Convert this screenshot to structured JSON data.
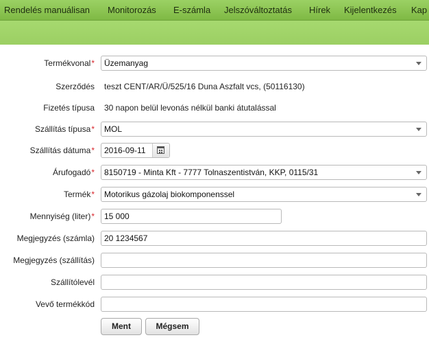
{
  "nav": {
    "items": [
      "Rendelés manuálisan",
      "Monitorozás",
      "E-számla",
      "Jelszóváltoztatás",
      "Hírek",
      "Kijelentkezés",
      "Kap"
    ]
  },
  "form": {
    "required_mark": "*",
    "termekvonal": {
      "label": "Termékvonal",
      "value": "Üzemanyag"
    },
    "szerzodes": {
      "label": "Szerződés",
      "value": "teszt CENT/AR/Ü/525/16 Duna Aszfalt vcs, (50116130)"
    },
    "fizetes": {
      "label": "Fizetés típusa",
      "value": "30 napon belül levonás nélkül banki átutalással"
    },
    "szallitas_tipusa": {
      "label": "Szállítás típusa",
      "value": "MOL"
    },
    "szallitas_datuma": {
      "label": "Szállítás dátuma",
      "value": "2016-09-11"
    },
    "arufogado": {
      "label": "Árufogadó",
      "value": "8150719 - Minta Kft - 7777 Tolnaszentistván, KKP, 0115/31"
    },
    "termek": {
      "label": "Termék",
      "value": "Motorikus gázolaj biokomponenssel"
    },
    "mennyiseg": {
      "label": "Mennyiség (liter)",
      "value": "15 000"
    },
    "megj_szamla": {
      "label": "Megjegyzés (számla)",
      "value": "20 1234567"
    },
    "megj_szallitas": {
      "label": "Megjegyzés (szállítás)",
      "value": ""
    },
    "szallitolevel": {
      "label": "Szállítólevél",
      "value": ""
    },
    "vevo_termekkod": {
      "label": "Vevő termékkód",
      "value": ""
    }
  },
  "buttons": {
    "save": "Ment",
    "cancel": "Mégsem"
  }
}
